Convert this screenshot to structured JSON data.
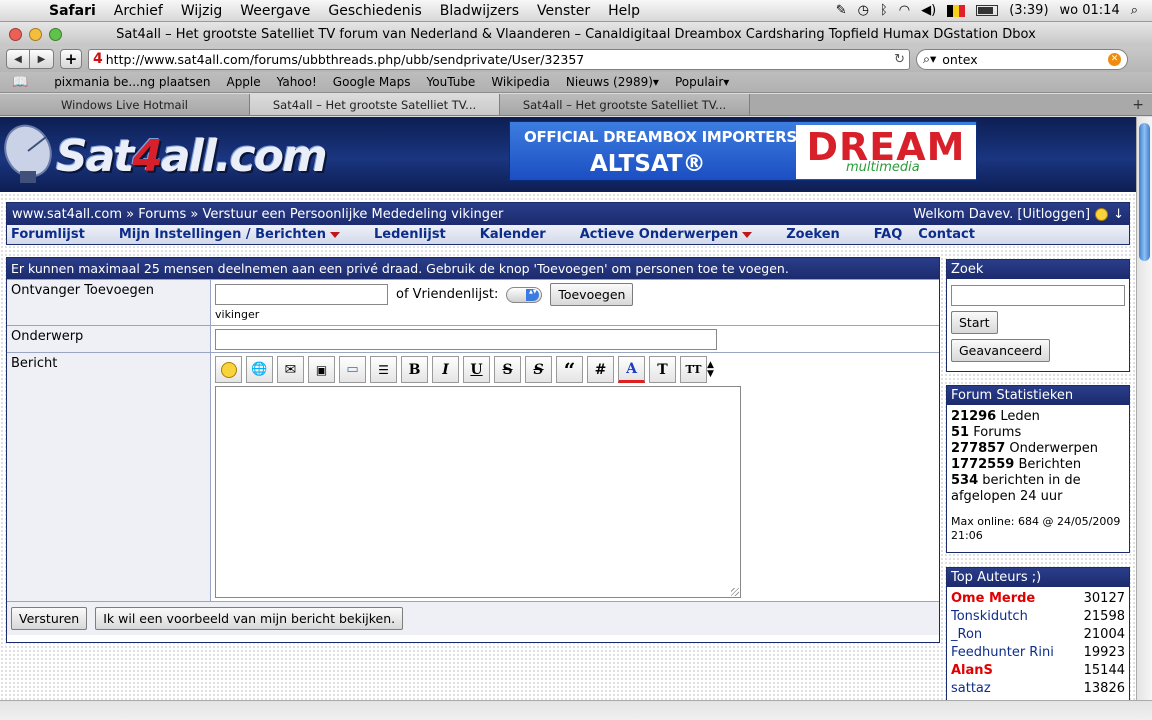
{
  "menubar": {
    "app": "Safari",
    "items": [
      "Archief",
      "Wijzig",
      "Weergave",
      "Geschiedenis",
      "Bladwijzers",
      "Venster",
      "Help"
    ],
    "battery": "(3:39)",
    "clock": "wo 01:14"
  },
  "window": {
    "title": "Sat4all – Het grootste Satelliet TV forum van Nederland & Vlaanderen – Canaldigitaal Dreambox Cardsharing Topfield Humax DGstation Dbox"
  },
  "toolbar": {
    "url": "http://www.sat4all.com/forums/ubbthreads.php/ubb/sendprivate/User/32357",
    "search_value": "ontex"
  },
  "bookmarks": [
    "pixmania be...ng plaatsen",
    "Apple",
    "Yahoo!",
    "Google Maps",
    "YouTube",
    "Wikipedia",
    "Nieuws (2989)▾",
    "Populair▾"
  ],
  "tabs": [
    {
      "label": "Windows Live Hotmail"
    },
    {
      "label": "Sat4all – Het grootste Satelliet TV..."
    },
    {
      "label": "Sat4all – Het grootste Satelliet TV..."
    }
  ],
  "banner": {
    "logo_pre": "Sat",
    "logo_four": "4",
    "logo_post": "all.com",
    "ad_line1": "OFFICIAL DREAMBOX IMPORTERS",
    "ad_line2": "ALTSAT®",
    "ad_brand": "DREAM",
    "ad_sub": "multimedia"
  },
  "breadcrumb": {
    "text": "www.sat4all.com » Forums » Verstuur een Persoonlijke Mededeling vikinger",
    "welcome": "Welkom Davev. [Uitloggen]",
    "arrow": "↓"
  },
  "nav": {
    "forumlijst": "Forumlijst",
    "instellingen": "Mijn Instellingen / Berichten",
    "ledenlijst": "Ledenlijst",
    "kalender": "Kalender",
    "actieve": "Actieve Onderwerpen",
    "zoeken": "Zoeken",
    "faq": "FAQ",
    "contact": "Contact"
  },
  "form": {
    "info": "Er kunnen maximaal 25 mensen deelnemen aan een privé draad. Gebruik de knop 'Toevoegen' om personen toe te voegen.",
    "recipient_label": "Ontvanger Toevoegen",
    "recipient_value": "",
    "friends_label": "of Vriendenlijst:",
    "add_button": "Toevoegen",
    "recipient_name": "vikinger",
    "subject_label": "Onderwerp",
    "subject_value": "",
    "message_label": "Bericht",
    "submit_button": "Versturen",
    "preview_button": "Ik wil een voorbeeld van mijn bericht bekijken."
  },
  "editor": {
    "bold": "B",
    "italic": "I",
    "underline": "U",
    "strike": "S",
    "spoiler": "S",
    "quote": "“",
    "code": "#",
    "color": "A",
    "font": "T",
    "size": "TT"
  },
  "search_box": {
    "title": "Zoek",
    "value": "",
    "start": "Start",
    "advanced": "Geavanceerd"
  },
  "stats": {
    "title": "Forum Statistieken",
    "members_n": "21296",
    "members_l": "Leden",
    "forums_n": "51",
    "forums_l": "Forums",
    "topics_n": "277857",
    "topics_l": "Onderwerpen",
    "posts_n": "1772559",
    "posts_l": "Berichten",
    "recent_n": "534",
    "recent_l": "berichten in de afgelopen 24 uur",
    "max_online": "Max online: 684 @ 24/05/2009 21:06"
  },
  "top_authors": {
    "title": "Top Auteurs ;)",
    "rows": [
      {
        "name": "Ome Merde",
        "count": "30127",
        "highlight": true
      },
      {
        "name": "Tonskidutch",
        "count": "21598",
        "highlight": false
      },
      {
        "name": "_Ron",
        "count": "21004",
        "highlight": false
      },
      {
        "name": "Feedhunter Rini",
        "count": "19923",
        "highlight": false
      },
      {
        "name": "AlanS",
        "count": "15144",
        "highlight": true
      },
      {
        "name": "sattaz",
        "count": "13826",
        "highlight": false
      }
    ]
  },
  "colors": {
    "header_blue": "#1c2b6e",
    "link_blue": "#0d2d8a",
    "accent_red": "#e00000"
  }
}
